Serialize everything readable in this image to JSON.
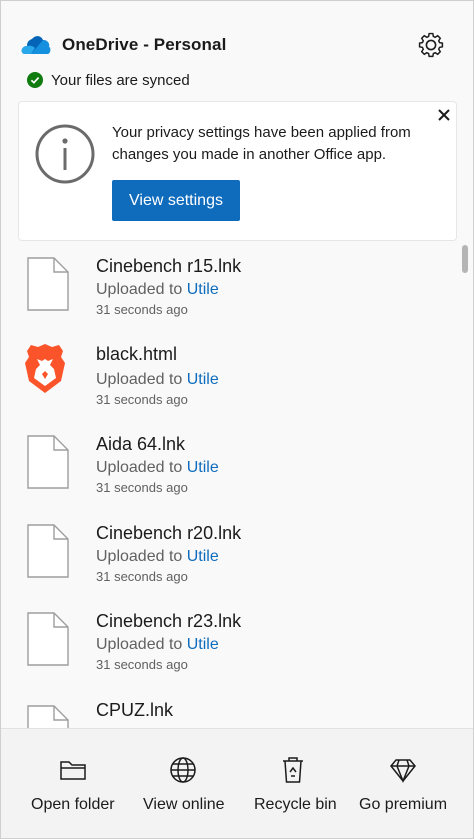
{
  "header": {
    "title": "OneDrive - Personal",
    "sync_status": "Your files are synced"
  },
  "notice": {
    "message": "Your privacy settings have been applied from changes you made in another Office app.",
    "button_label": "View settings"
  },
  "files": [
    {
      "name": "Cinebench r15.lnk",
      "status_prefix": "Uploaded to",
      "folder": "Utile",
      "time": "31 seconds ago",
      "icon": "generic-file-icon"
    },
    {
      "name": "black.html",
      "status_prefix": "Uploaded to",
      "folder": "Utile",
      "time": "31 seconds ago",
      "icon": "brave-browser-icon"
    },
    {
      "name": "Aida 64.lnk",
      "status_prefix": "Uploaded to",
      "folder": "Utile",
      "time": "31 seconds ago",
      "icon": "generic-file-icon"
    },
    {
      "name": "Cinebench r20.lnk",
      "status_prefix": "Uploaded to",
      "folder": "Utile",
      "time": "31 seconds ago",
      "icon": "generic-file-icon"
    },
    {
      "name": "Cinebench r23.lnk",
      "status_prefix": "Uploaded to",
      "folder": "Utile",
      "time": "31 seconds ago",
      "icon": "generic-file-icon"
    },
    {
      "name": "CPUZ.lnk",
      "status_prefix": "",
      "folder": "",
      "time": "",
      "icon": "generic-file-icon"
    }
  ],
  "footer": {
    "open_folder": "Open folder",
    "view_online": "View online",
    "recycle_bin": "Recycle bin",
    "go_premium": "Go premium"
  },
  "colors": {
    "accent": "#0f6cbd",
    "sync_ok": "#107c10",
    "brave": "#fb542b"
  }
}
